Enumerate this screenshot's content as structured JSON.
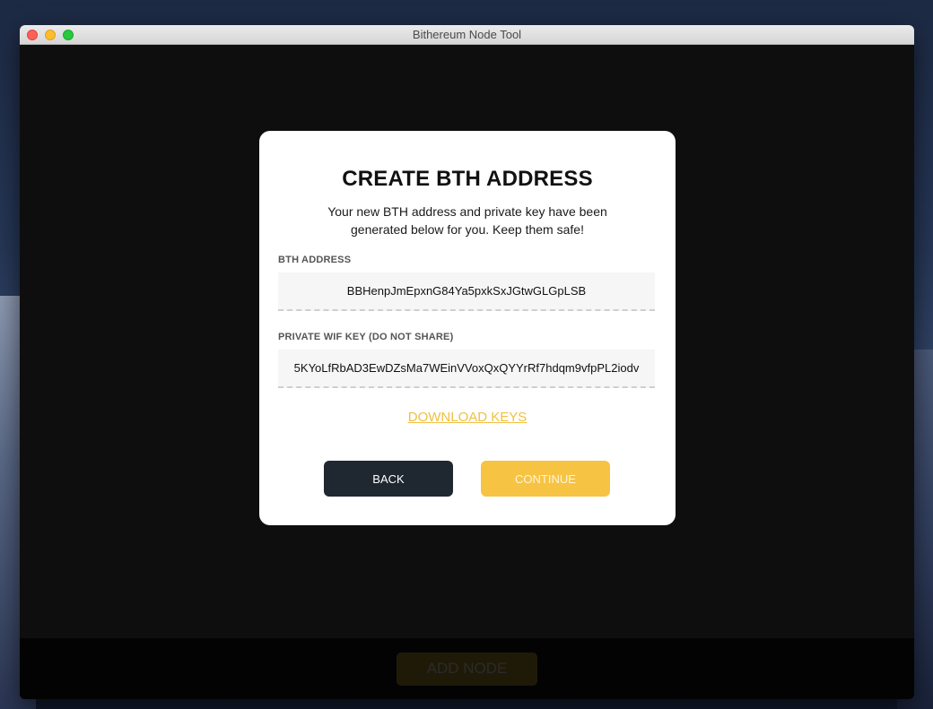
{
  "window": {
    "title": "Bithereum Node Tool"
  },
  "modal": {
    "title": "CREATE BTH ADDRESS",
    "description": "Your new BTH address and private key have been generated below for you. Keep them safe!",
    "address_label": "BTH ADDRESS",
    "address_value": "BBHenpJmEpxnG84Ya5pxkSxJGtwGLGpLSB",
    "key_label": "PRIVATE WIF KEY (DO NOT SHARE)",
    "key_value": "5KYoLfRbAD3EwDZsMa7WEinVVoxQxQYYrRf7hdqm9vfpPL2iodv",
    "download_label": "DOWNLOAD KEYS",
    "back_label": "BACK",
    "continue_label": "CONTINUE"
  },
  "footer": {
    "add_node_label": "ADD NODE"
  },
  "colors": {
    "accent": "#f7c342",
    "dark_button": "#1f2730",
    "overlay": "#0e0e0e"
  }
}
